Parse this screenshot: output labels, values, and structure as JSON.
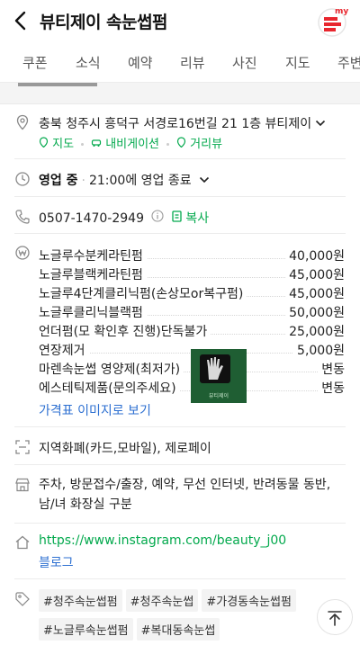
{
  "header": {
    "title": "뷰티제이 속눈썹펌",
    "logo_text": "my"
  },
  "tabs": [
    {
      "label": "쿠폰"
    },
    {
      "label": "소식"
    },
    {
      "label": "예약"
    },
    {
      "label": "리뷰"
    },
    {
      "label": "사진"
    },
    {
      "label": "지도"
    },
    {
      "label": "주변"
    }
  ],
  "address": {
    "text": "충북 청주시 흥덕구 서경로16번길 21 1층 뷰티제이",
    "links": [
      "지도",
      "내비게이션",
      "거리뷰"
    ]
  },
  "hours": {
    "status": "영업 중",
    "detail": "21:00에 영업 종료"
  },
  "phone": {
    "number": "0507-1470-2949",
    "copy_label": "복사"
  },
  "menu": {
    "items": [
      {
        "name": "노글루수분케라틴펌",
        "price": "40,000원"
      },
      {
        "name": "노글루블랙케라틴펌",
        "price": "45,000원"
      },
      {
        "name": "노글루4단계클리닉펌(손상모or복구펌)",
        "price": "45,000원"
      },
      {
        "name": "노글루클리닉블랙펌",
        "price": "50,000원"
      },
      {
        "name": "언더펌(모 확인후 진행)단독불가",
        "price": "25,000원"
      },
      {
        "name": "연장제거",
        "price": "5,000원"
      },
      {
        "name": "마렌속눈썹 영양제(최저가)",
        "price": "변동"
      },
      {
        "name": "에스테틱제품(문의주세요)",
        "price": "변동"
      }
    ],
    "thumb_caption": "뷰티제이",
    "price_image_link": "가격표 이미지로 보기"
  },
  "payment": "지역화폐(카드,모바일), 제로페이",
  "amenities": "주차, 방문접수/출장, 예약, 무선 인터넷, 반려동물 동반, 남/녀 화장실 구분",
  "links": {
    "instagram": "https://www.instagram.com/beauty_j00",
    "blog": "블로그"
  },
  "tags": [
    "#청주속눈썹펌",
    "#청주속눈썹",
    "#가경동속눈썹펌",
    "#노글루속눈썹펌",
    "#복대동속눈썹"
  ],
  "colors": {
    "accent_green": "#03a94d",
    "link_blue": "#2c6fd1",
    "logo_red": "#e8262e"
  }
}
